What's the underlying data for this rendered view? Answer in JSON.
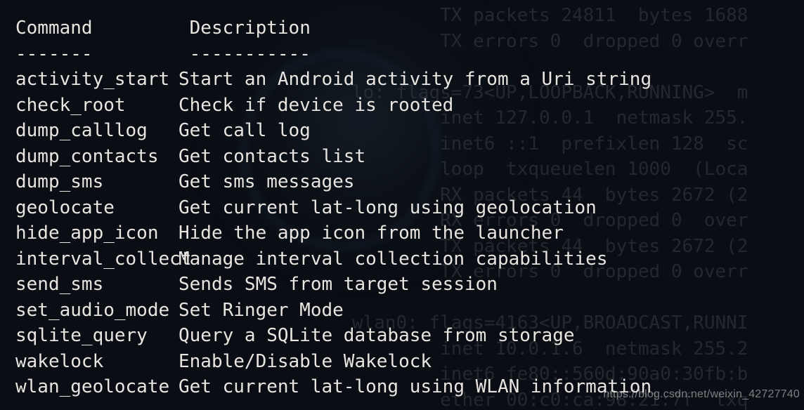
{
  "headers": {
    "command": "Command",
    "description": "Description"
  },
  "dividers": {
    "command": "-------",
    "description": "-----------"
  },
  "commands": [
    {
      "cmd": "activity_start",
      "desc": "Start an Android activity from a Uri string"
    },
    {
      "cmd": "check_root",
      "desc": "Check if device is rooted"
    },
    {
      "cmd": "dump_calllog",
      "desc": "Get call log"
    },
    {
      "cmd": "dump_contacts",
      "desc": "Get contacts list"
    },
    {
      "cmd": "dump_sms",
      "desc": "Get sms messages"
    },
    {
      "cmd": "geolocate",
      "desc": "Get current lat-long using geolocation"
    },
    {
      "cmd": "hide_app_icon",
      "desc": "Hide the app icon from the launcher"
    },
    {
      "cmd": "interval_collect",
      "desc": "Manage interval collection capabilities"
    },
    {
      "cmd": "send_sms",
      "desc": "Sends SMS from target session"
    },
    {
      "cmd": "set_audio_mode",
      "desc": "Set Ringer Mode"
    },
    {
      "cmd": "sqlite_query",
      "desc": "Query a SQLite database from storage"
    },
    {
      "cmd": "wakelock",
      "desc": "Enable/Disable Wakelock"
    },
    {
      "cmd": "wlan_geolocate",
      "desc": "Get current lat-long using WLAN information"
    }
  ],
  "ghost_lines": [
    "                                        TX packets 24811  bytes 1688",
    "                                        TX errors 0  dropped 0 overr",
    "",
    "                                lo: flags=73<UP,LOOPBACK,RUNNING>  m",
    "                                        inet 127.0.0.1  netmask 255.",
    "                                        inet6 ::1  prefixlen 128  sc",
    "                                        loop  txqueuelen 1000  (Loca",
    "                                        RX packets 44  bytes 2672 (2",
    "                                        RX errors 0  dropped 0  over",
    "                                        TX packets 44  bytes 2672 (2",
    "                                        TX errors 0  dropped 0 overr",
    "",
    "                                wlan0: flags=4163<UP,BROADCAST,RUNNI",
    "                                        inet 10.0.1.6  netmask 255.2",
    "                                        inet6 fe80::560d:90a0:30fb:b",
    "                                        ether 00:c0:ca:98:21:7f  txq"
  ],
  "watermark": "https://blog.csdn.net/weixin_42727740"
}
